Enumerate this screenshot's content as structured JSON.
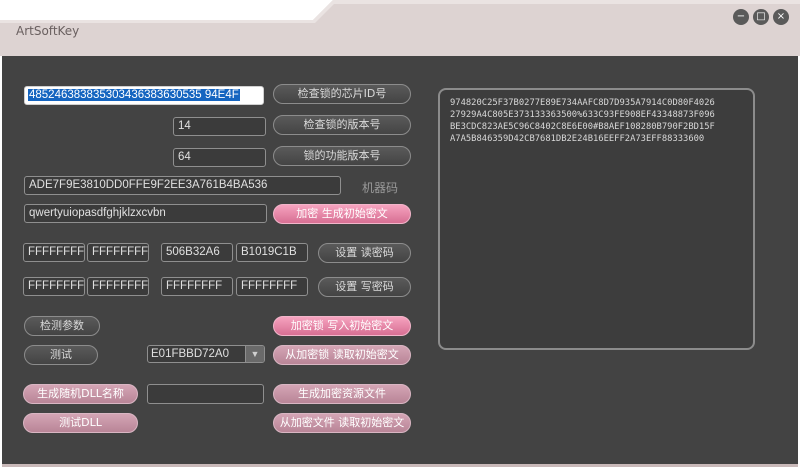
{
  "window": {
    "title": "ArtSoftKey",
    "minimize_glyph": "−",
    "maximize_glyph": "□",
    "close_glyph": "×"
  },
  "fields": {
    "chip_id": "485246383835303436383630535 94E4F",
    "version": "14",
    "function_version": "64",
    "machine_code": "ADE7F9E3810DD0FFE9F2EE3A761B4BA536",
    "seed": "qwertyuiopasdfghjklzxcvbn",
    "read_pw_1": "FFFFFFFF",
    "read_pw_2": "FFFFFFFF",
    "read_pw_3": "506B32A6",
    "read_pw_4": "B1019C1B",
    "write_pw_1": "FFFFFFFF",
    "write_pw_2": "FFFFFFFF",
    "write_pw_3": "FFFFFFFF",
    "write_pw_4": "FFFFFFFF",
    "dll_name": "",
    "combo_value": "E01FBBD72A0"
  },
  "labels": {
    "machine_code": "机器码"
  },
  "buttons": {
    "check_chip_id": "检查锁的芯片ID号",
    "check_version": "检查锁的版本号",
    "function_version": "锁的功能版本号",
    "encrypt_generate": "加密 生成初始密文",
    "set_read_pw": "设置 读密码",
    "set_write_pw": "设置 写密码",
    "detect_params": "检测参数",
    "test": "测试",
    "write_to_lock": "加密锁 写入初始密文",
    "read_from_lock": "从加密锁 读取初始密文",
    "gen_random_dll": "生成随机DLL名称",
    "gen_resource": "生成加密资源文件",
    "test_dll": "测试DLL",
    "read_from_file": "从加密文件 读取初始密文"
  },
  "output_lines": [
    "974820C25F37B0277E89E734AAFC8D7D935A7914C0D80F4026",
    "27929A4C805E373133363500%633C93FE908EF43348873F096",
    "BE3CDC823AE5C96C8402C8E6E00#B8AEF108280B790F2BD15F",
    "A7A5B846359D42CB7681DB2E24B16EEFF2A73EFF88333600"
  ],
  "colors": {
    "accent_pink": "#e0789c",
    "selection_blue": "#1565c0",
    "background": "#434343"
  }
}
